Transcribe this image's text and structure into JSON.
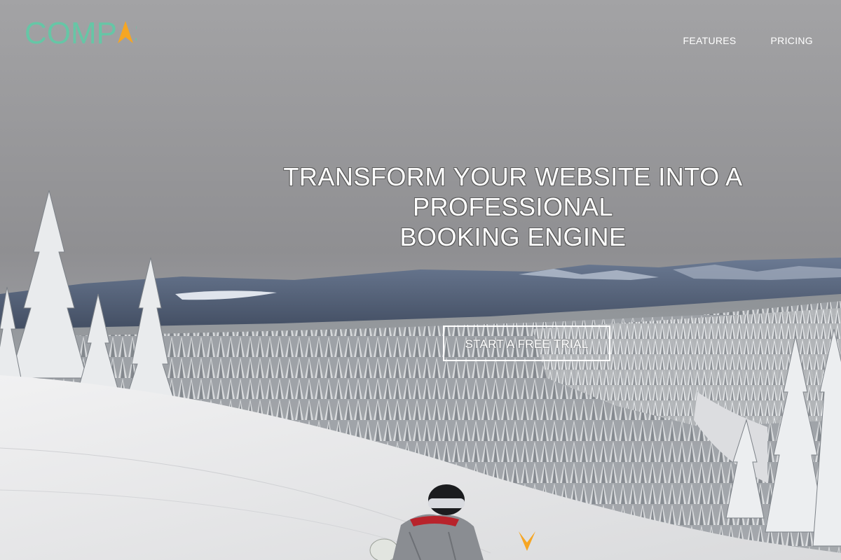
{
  "brand": {
    "name": "COMPASS",
    "wordmark_color": "#66c6a6",
    "accent_color": "#f6a623"
  },
  "nav": {
    "items": [
      {
        "label": "FEATURES"
      },
      {
        "label": "PRICING"
      }
    ]
  },
  "hero": {
    "headline_line1": "TRANSFORM YOUR WEBSITE INTO A PROFESSIONAL",
    "headline_line2": "BOOKING ENGINE",
    "cta_label": "START A FREE TRIAL",
    "background": "snowy-forest-mountain-landscape-with-snowboarder",
    "scroll_icon": "chevron-down-icon"
  }
}
